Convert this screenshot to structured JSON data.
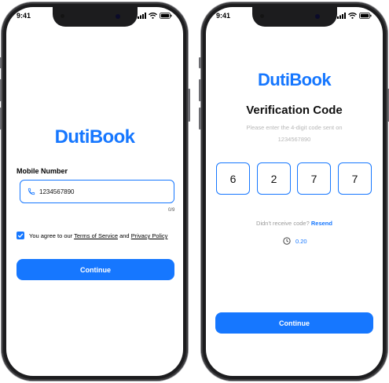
{
  "screen1": {
    "status_time": "9:41",
    "app_logo": "DutiBook",
    "mobile_label": "Mobile Number",
    "phone_value": "1234567890",
    "phone_icon": "phone-icon",
    "counter": "0/9",
    "agree_prefix": "You agree to our ",
    "terms_link": "Terms of Service",
    "agree_and": " and ",
    "privacy_link": "Privacy Policy",
    "agree_checked": true,
    "continue_label": "Continue"
  },
  "screen2": {
    "status_time": "9:41",
    "app_logo": "DutiBook",
    "title": "Verification Code",
    "subtitle_line1": "Please enter the 4-digit code sent on",
    "subtitle_line2": "1234567890",
    "otp_digits": [
      "6",
      "2",
      "7",
      "7"
    ],
    "resend_prompt": "Didn't receive code?",
    "resend_link": "Resend",
    "timer_icon": "clock-icon",
    "timer_value": "0.20",
    "continue_label": "Continue"
  },
  "colors": {
    "accent": "#1677ff",
    "frame": "#1c1c1e",
    "muted_text": "#b7b7b7"
  }
}
